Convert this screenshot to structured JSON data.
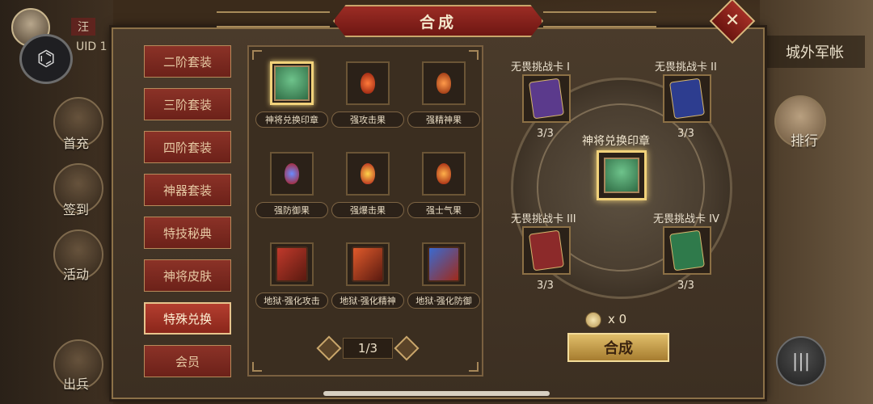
{
  "hud": {
    "player_name": "汪",
    "uid_label": "UID 1",
    "left_menu": [
      "首充",
      "签到",
      "活动",
      "出兵"
    ],
    "city_label": "城外军帐",
    "rank_label": "排行"
  },
  "dialog": {
    "title": "合成",
    "close_label": "✕",
    "tabs": [
      {
        "label": "二阶套装",
        "active": false
      },
      {
        "label": "三阶套装",
        "active": false
      },
      {
        "label": "四阶套装",
        "active": false
      },
      {
        "label": "神器套装",
        "active": false
      },
      {
        "label": "特技秘典",
        "active": false
      },
      {
        "label": "神将皮肤",
        "active": false
      },
      {
        "label": "特殊兑换",
        "active": true
      },
      {
        "label": "会员",
        "active": false
      }
    ],
    "items": [
      {
        "name": "神将兑换印章",
        "icon": "seal-icon",
        "selected": true
      },
      {
        "name": "强攻击果",
        "icon": "fruit-icon",
        "selected": false
      },
      {
        "name": "强精神果",
        "icon": "fruit-icon",
        "selected": false
      },
      {
        "name": "强防御果",
        "icon": "fruit-icon",
        "selected": false
      },
      {
        "name": "强爆击果",
        "icon": "fruit-icon",
        "selected": false
      },
      {
        "name": "强士气果",
        "icon": "fruit-icon",
        "selected": false
      },
      {
        "name": "地狱·强化攻击",
        "icon": "book-icon",
        "selected": false
      },
      {
        "name": "地狱·强化精神",
        "icon": "book-icon",
        "selected": false
      },
      {
        "name": "地狱·强化防御",
        "icon": "book-icon",
        "selected": false
      }
    ],
    "pager": "1/3",
    "recipe": {
      "target_name": "神将兑换印章",
      "materials": [
        {
          "name": "无畏挑战卡 I",
          "count": "3/3",
          "color": "#5b3a8c"
        },
        {
          "name": "无畏挑战卡 II",
          "count": "3/3",
          "color": "#2d3d8f"
        },
        {
          "name": "无畏挑战卡 III",
          "count": "3/3",
          "color": "#8c2a2a"
        },
        {
          "name": "无畏挑战卡 IV",
          "count": "3/3",
          "color": "#2f7a4b"
        }
      ],
      "cost": "x 0",
      "compose_label": "合成"
    }
  }
}
